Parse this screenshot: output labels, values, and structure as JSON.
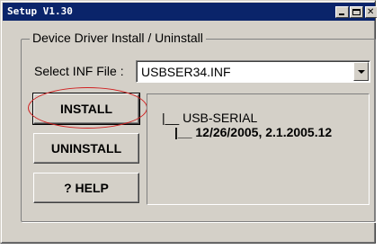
{
  "window": {
    "title": "Setup V1.30",
    "controls": {
      "minimize_icon": "minimize-icon",
      "maximize_icon": "maximize-icon",
      "close_icon": "close-icon"
    }
  },
  "group": {
    "label": "Device Driver Install / Uninstall"
  },
  "inf": {
    "label": "Select INF File :",
    "selected": "USBSER34.INF"
  },
  "buttons": {
    "install": "INSTALL",
    "uninstall": "UNINSTALL",
    "help": "? HELP"
  },
  "info": {
    "line1": "|__ USB-SERIAL",
    "line2": "|__ 12/26/2005, 2.1.2005.12"
  },
  "annotation": {
    "highlight_color": "#d02020"
  }
}
